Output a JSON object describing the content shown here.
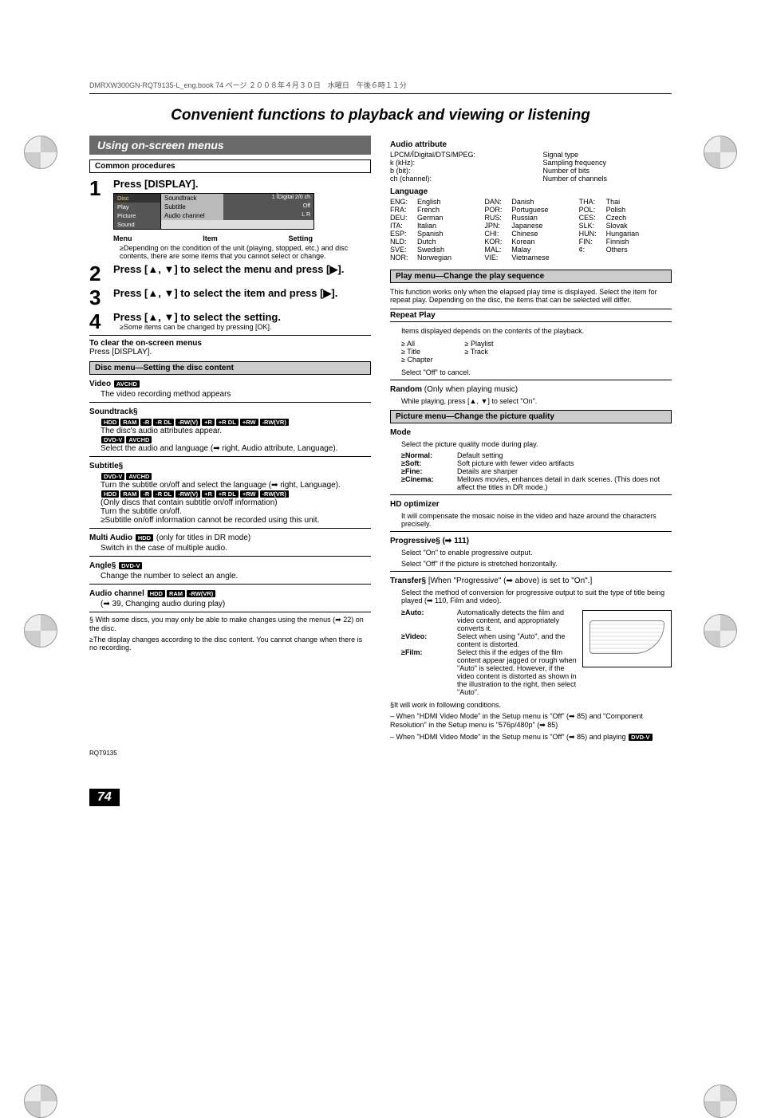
{
  "header_line": "DMRXW300GN-RQT9135-L_eng.book  74 ページ  ２００８年４月３０日　水曜日　午後６時１１分",
  "page_title": "Convenient functions to playback and viewing or listening",
  "left": {
    "section_bar": "Using on-screen menus",
    "common_procedures": "Common procedures",
    "step1": {
      "instr": "Press [DISPLAY].",
      "osd_left": [
        "Disc",
        "Play",
        "Picture",
        "Sound"
      ],
      "osd_items": [
        "Soundtrack",
        "Subtitle",
        "Audio channel"
      ],
      "osd_vals_top": "1   ÎDigital 2/0 ch",
      "osd_vals_sub": "Off",
      "osd_vals_ch": "L R",
      "labels": {
        "menu": "Menu",
        "item": "Item",
        "setting": "Setting"
      },
      "note": "≥Depending on the condition of the unit (playing, stopped, etc.) and disc contents, there are some items that you cannot select or change."
    },
    "step2": "Press [▲, ▼] to select the menu and press [▶].",
    "step3": "Press [▲, ▼] to select the item and press [▶].",
    "step4": "Press [▲, ▼] to select the setting.",
    "step4_note": "≥Some items can be changed by pressing [OK].",
    "clear_h": "To clear the on-screen menus",
    "clear_t": "Press [DISPLAY].",
    "disc_menu_bar": "Disc menu—Setting the disc content",
    "video_h": "Video",
    "video_badge": "AVCHD",
    "video_t": "The video recording method appears",
    "soundtrack_h": "Soundtrack§",
    "soundtrack_badges1": [
      "HDD",
      "RAM",
      "-R",
      "-R DL",
      "-RW(V)",
      "+R",
      "+R DL",
      "+RW",
      "-RW(VR)"
    ],
    "soundtrack_l1": "The disc's audio attributes appear.",
    "soundtrack_badges2": [
      "DVD-V",
      "AVCHD"
    ],
    "soundtrack_l2": "Select the audio and language (➡ right, Audio attribute, Language).",
    "subtitle_h": "Subtitle§",
    "subtitle_badges1": [
      "DVD-V",
      "AVCHD"
    ],
    "subtitle_l1": "Turn the subtitle on/off and select the language (➡ right, Language).",
    "subtitle_badges2": [
      "HDD",
      "RAM",
      "-R",
      "-R DL",
      "-RW(V)",
      "+R",
      "+R DL",
      "+RW",
      "-RW(VR)"
    ],
    "subtitle_l2": "(Only discs that contain subtitle on/off information)",
    "subtitle_l3": "Turn the subtitle on/off.",
    "subtitle_l4": "≥Subtitle on/off information cannot be recorded using this unit.",
    "multi_h": "Multi Audio",
    "multi_badge": "HDD",
    "multi_paren": "(only for titles in DR mode)",
    "multi_t": "Switch in the case of multiple audio.",
    "angle_h": "Angle§",
    "angle_badge": "DVD-V",
    "angle_t": "Change the number to select an angle.",
    "audio_ch_h": "Audio channel",
    "audio_ch_badges": [
      "HDD",
      "RAM",
      "-RW(VR)"
    ],
    "audio_ch_t": "(➡ 39, Changing audio during play)",
    "foot1": "§ With some discs, you may only be able to make changes using the menus (➡ 22) on the disc.",
    "foot2": "≥The display changes according to the disc content. You cannot change when there is no recording."
  },
  "right": {
    "audio_attr_h": "Audio attribute",
    "audio_attr_left": [
      "LPCM/ÎDigital/DTS/MPEG:",
      "k (kHz):",
      "b (bit):",
      "ch (channel):"
    ],
    "audio_attr_right": [
      "Signal type",
      "Sampling frequency",
      "Number of bits",
      "Number of channels"
    ],
    "lang_h": "Language",
    "langs": [
      [
        "ENG:",
        "English",
        "DAN:",
        "Danish",
        "THA:",
        "Thai"
      ],
      [
        "FRA:",
        "French",
        "POR:",
        "Portuguese",
        "POL:",
        "Polish"
      ],
      [
        "DEU:",
        "German",
        "RUS:",
        "Russian",
        "CES:",
        "Czech"
      ],
      [
        "ITA:",
        "Italian",
        "JPN:",
        "Japanese",
        "SLK:",
        "Slovak"
      ],
      [
        "ESP:",
        "Spanish",
        "CHI:",
        "Chinese",
        "HUN:",
        "Hungarian"
      ],
      [
        "NLD:",
        "Dutch",
        "KOR:",
        "Korean",
        "FIN:",
        "Finnish"
      ],
      [
        "SVE:",
        "Swedish",
        "MAL:",
        "Malay",
        "¢:",
        "Others"
      ],
      [
        "NOR:",
        "Norwegian",
        "VIE:",
        "Vietnamese",
        "",
        ""
      ]
    ],
    "play_menu_bar": "Play menu—Change the play sequence",
    "play_intro": "This function works only when the elapsed play time is displayed. Select the item for repeat play. Depending on the disc, the items that can be selected will differ.",
    "repeat_h": "Repeat Play",
    "repeat_t": "Items displayed depends on the contents of the playback.",
    "repeat_items_l": [
      "All",
      "Title",
      "Chapter"
    ],
    "repeat_items_r": [
      "Playlist",
      "Track"
    ],
    "repeat_off": "Select \"Off\" to cancel.",
    "random_h": "Random",
    "random_paren": "(Only when playing music)",
    "random_t": "While playing, press [▲, ▼] to select \"On\".",
    "picture_bar": "Picture menu—Change the picture quality",
    "mode_h": "Mode",
    "mode_t": "Select the picture quality mode during play.",
    "modes": [
      {
        "k": "≥Normal:",
        "v": "Default setting"
      },
      {
        "k": "≥Soft:",
        "v": "Soft picture with fewer video artifacts"
      },
      {
        "k": "≥Fine:",
        "v": "Details are sharper"
      },
      {
        "k": "≥Cinema:",
        "v": "Mellows movies, enhances detail in dark scenes. (This does not affect the titles in DR mode.)"
      }
    ],
    "hdopt_h": "HD optimizer",
    "hdopt_t": "It will compensate the mosaic noise in the video and haze around the characters precisely.",
    "prog_h": "Progressive§ (➡ 111)",
    "prog_t1": "Select \"On\" to enable progressive output.",
    "prog_t2": "Select \"Off\" if the picture is stretched horizontally.",
    "transfer_h": "Transfer§",
    "transfer_cond": "[When \"Progressive\" (➡ above) is set to \"On\".]",
    "transfer_intro": "Select the method of conversion for progressive output to suit the type of title being played (➡ 110, Film and video).",
    "transfer_items": [
      {
        "k": "≥Auto:",
        "v": "Automatically detects the film and video content, and appropriately converts it."
      },
      {
        "k": "≥Video:",
        "v": "Select when using \"Auto\", and the content is distorted."
      },
      {
        "k": "≥Film:",
        "v": "Select this if the edges of the film content appear jagged or rough when \"Auto\" is selected. However, if the video content is distorted as shown in the illustration to the right, then select \"Auto\"."
      }
    ],
    "foot_h": "§It will work in following conditions.",
    "foot1": "– When \"HDMI Video Mode\" in the Setup menu is \"Off\" (➡ 85) and \"Component Resolution\" in the Setup menu is \"576p/480p\" (➡ 85)",
    "foot2": "– When \"HDMI Video Mode\" in the Setup menu is \"Off\" (➡ 85) and playing",
    "foot2_badge": "DVD-V"
  },
  "page_num": "74",
  "rqt": "RQT9135"
}
